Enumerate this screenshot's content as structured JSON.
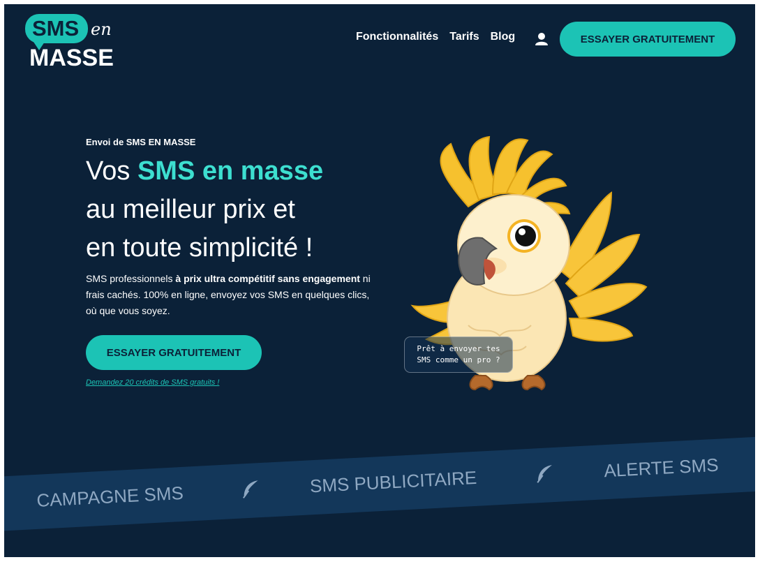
{
  "brand": {
    "logo_top": "SMS",
    "logo_script": "en",
    "logo_bottom": "MASSE",
    "accent_color": "#1cc3b5",
    "background_color": "#0b2138"
  },
  "nav": {
    "items": [
      "Fonctionnalités",
      "Tarifs",
      "Blog"
    ],
    "user_icon": "user-icon",
    "cta_label": "ESSAYER GRATUITEMENT"
  },
  "hero": {
    "eyebrow": "Envoi de SMS EN MASSE",
    "headline_part1": "Vos ",
    "headline_accent": "SMS en masse",
    "headline_line2": "au meilleur prix et",
    "headline_line3": "en toute simplicité !",
    "desc_part1": "SMS professionnels ",
    "desc_bold": "à prix ultra compétitif sans engagement",
    "desc_part2": " ni frais cachés. 100% en ligne, envoyez vos SMS en quelques clics, où que vous soyez.",
    "cta_label": "ESSAYER GRATUITEMENT",
    "free_link": "Demandez 20 crédits de SMS gratuits !",
    "speech_bubble_line1": "Prêt à envoyer tes",
    "speech_bubble_line2": "SMS comme un pro ?",
    "mascot": "cockatoo-mascot"
  },
  "marquee": {
    "items": [
      "CAMPAGNE SMS",
      "SMS PUBLICITAIRE",
      "ALERTE SMS"
    ],
    "separator_icon": "feather-icon"
  }
}
